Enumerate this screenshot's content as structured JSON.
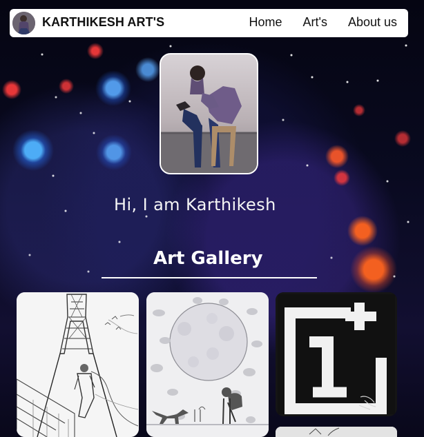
{
  "header": {
    "brand": "KARTHIKESH ART'S",
    "nav": [
      "Home",
      "Art's",
      "About us"
    ]
  },
  "hero": {
    "greeting": "Hi, I am Karthikesh"
  },
  "gallery": {
    "title": "Art Gallery",
    "cards": [
      {
        "subject": "eiffel-tower-sketch"
      },
      {
        "subject": "moon-and-dog-sketch"
      },
      {
        "subject": "logo-painting"
      },
      {
        "subject": "partially-visible-artwork"
      }
    ]
  },
  "colors": {
    "nav_bg": "#ffffff",
    "text": "#ffffff",
    "accent_blue": "#3aa2ff",
    "accent_red": "#ff4d3f"
  }
}
